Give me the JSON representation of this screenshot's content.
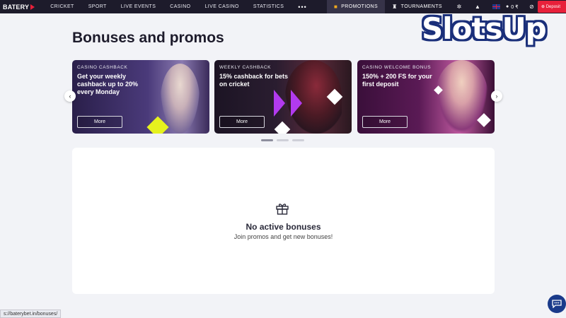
{
  "nav": {
    "logo": "BATERY",
    "items": [
      "CRICKET",
      "SPORT",
      "LIVE EVENTS",
      "CASINO",
      "LIVE CASINO",
      "STATISTICS"
    ],
    "more": "•••",
    "promotions": "PROMOTIONS",
    "tournaments": "TOURNAMENTS",
    "balance": "0 ₹",
    "deposit": "Deposit"
  },
  "watermark": "SlotsUp",
  "page": {
    "title": "Bonuses and promos"
  },
  "carousel": {
    "cards": [
      {
        "tag": "CASINO CASHBACK",
        "text": "Get your weekly cashback up to 20% every Monday",
        "button": "More"
      },
      {
        "tag": "WEEKLY CASHBACK",
        "text": "15% cashback for bets on cricket",
        "button": "More"
      },
      {
        "tag": "CASINO WELCOME BONUS",
        "text": "150% + 200 FS for your first deposit",
        "button": "More"
      }
    ],
    "prev": "‹",
    "next": "›",
    "active_index": 0
  },
  "empty": {
    "title": "No active bonuses",
    "subtitle": "Join promos and get new bonuses!"
  },
  "status_url": "s://baterybet.in/bonuses/",
  "colors": {
    "brand_red": "#e8203a",
    "nav_bg": "#1d1b2b",
    "accent_purple": "#b23aee",
    "accent_yellow": "#e6f21e"
  },
  "icons": [
    "gift-icon",
    "trophy-icon",
    "settings-icon",
    "bell-icon",
    "user-icon",
    "eye-off-icon",
    "chat-icon",
    "chevron-left-icon",
    "chevron-right-icon"
  ]
}
